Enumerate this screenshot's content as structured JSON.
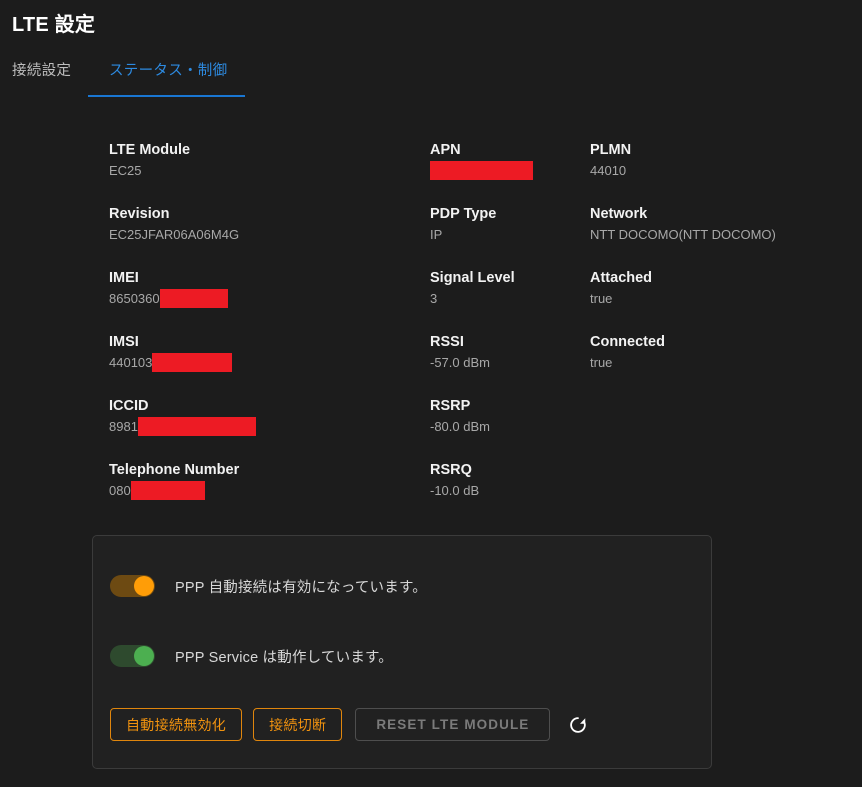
{
  "header": {
    "title": "LTE 設定"
  },
  "tabs": [
    {
      "label": "接続設定",
      "active": false
    },
    {
      "label": "ステータス・制御",
      "active": true
    }
  ],
  "accent_colors": {
    "tab_active": "#1976d2",
    "toggle_on_orange": "#ff9d07",
    "toggle_on_green": "#4caf50",
    "button_orange": "#f0920f",
    "redaction": "#ed1b24",
    "page_background": "#1c1c1c",
    "card_background": "#212121"
  },
  "info": {
    "column_1": [
      {
        "label": "LTE Module",
        "value": "EC25",
        "redacted": false,
        "redaction_width": 0
      },
      {
        "label": "Revision",
        "value": "EC25JFAR06A06M4G",
        "redacted": false,
        "redaction_width": 0
      },
      {
        "label": "IMEI",
        "value": "8650360",
        "redacted": true,
        "redaction_width": 68
      },
      {
        "label": "IMSI",
        "value": "440103",
        "redacted": true,
        "redaction_width": 80
      },
      {
        "label": "ICCID",
        "value": "8981",
        "redacted": true,
        "redaction_width": 118
      },
      {
        "label": "Telephone Number",
        "value": "080",
        "redacted": true,
        "redaction_width": 74
      }
    ],
    "column_2": [
      {
        "label": "APN",
        "value": "",
        "redacted": true,
        "redaction_width": 103
      },
      {
        "label": "PDP Type",
        "value": "IP",
        "redacted": false,
        "redaction_width": 0
      },
      {
        "label": "Signal Level",
        "value": "3",
        "redacted": false,
        "redaction_width": 0
      },
      {
        "label": "RSSI",
        "value": "-57.0 dBm",
        "redacted": false,
        "redaction_width": 0
      },
      {
        "label": "RSRP",
        "value": "-80.0 dBm",
        "redacted": false,
        "redaction_width": 0
      },
      {
        "label": "RSRQ",
        "value": "-10.0 dB",
        "redacted": false,
        "redaction_width": 0
      }
    ],
    "column_3": [
      {
        "label": "PLMN",
        "value": "44010",
        "redacted": false,
        "redaction_width": 0
      },
      {
        "label": "Network",
        "value": "NTT DOCOMO(NTT DOCOMO)",
        "redacted": false,
        "redaction_width": 0,
        "truncated": true
      },
      {
        "label": "Attached",
        "value": "true",
        "redacted": false,
        "redaction_width": 0
      },
      {
        "label": "Connected",
        "value": "true",
        "redacted": false,
        "redaction_width": 0
      }
    ]
  },
  "control_card": {
    "toggles": [
      {
        "label": "PPP 自動接続は有効になっています。",
        "state": "on",
        "color": "orange"
      },
      {
        "label": "PPP Service は動作しています。",
        "state": "on",
        "color": "green"
      }
    ],
    "buttons": [
      {
        "label": "自動接続無効化",
        "style": "orange",
        "disabled": false
      },
      {
        "label": "接続切断",
        "style": "orange",
        "disabled": false
      },
      {
        "label": "RESET LTE MODULE",
        "style": "disabled",
        "disabled": true
      }
    ],
    "refresh_icon": "refresh-icon"
  }
}
